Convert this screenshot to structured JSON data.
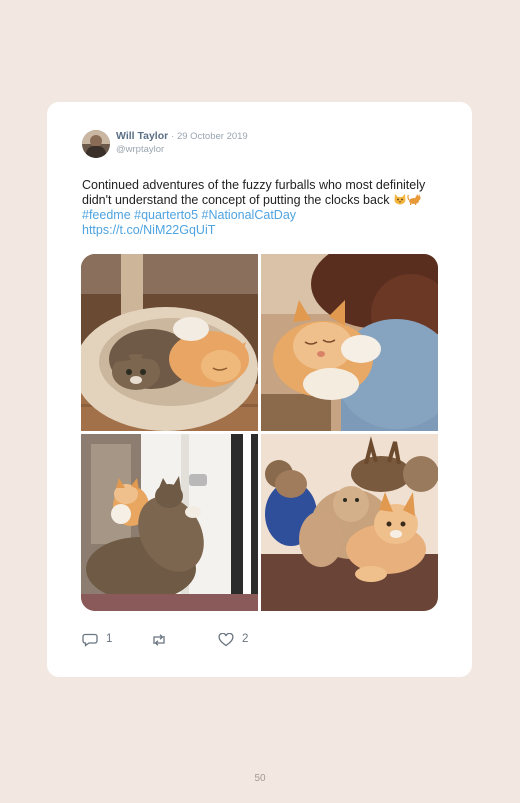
{
  "tweet": {
    "author_name": "Will Taylor",
    "date": "· 29 October 2019",
    "handle": "@wrptaylor",
    "text_part1": "Continued adventures of the fuzzy furballs who most definitely didn't understand the concept of putting the clocks back ",
    "emoji_names": [
      "cat-face-emoji",
      "cat-emoji"
    ],
    "hashtags": "#feedme #quarterto5 #NationalCatDay",
    "link": "https://t.co/NiM22GqUiT",
    "photos": [
      {
        "name": "photo-kittens-in-cat-bed"
      },
      {
        "name": "photo-ginger-kitten-on-shoulder"
      },
      {
        "name": "photo-kittens-at-door"
      },
      {
        "name": "photo-kitten-with-plush-toys"
      }
    ],
    "actions": {
      "reply_count": "1",
      "retweet_count": "",
      "like_count": "2"
    }
  },
  "page_number": "50",
  "colors": {
    "background": "#f3e8e1",
    "card": "#ffffff",
    "link": "#4fa3e0",
    "name": "#5b6f86",
    "muted": "#9aa5b1"
  }
}
